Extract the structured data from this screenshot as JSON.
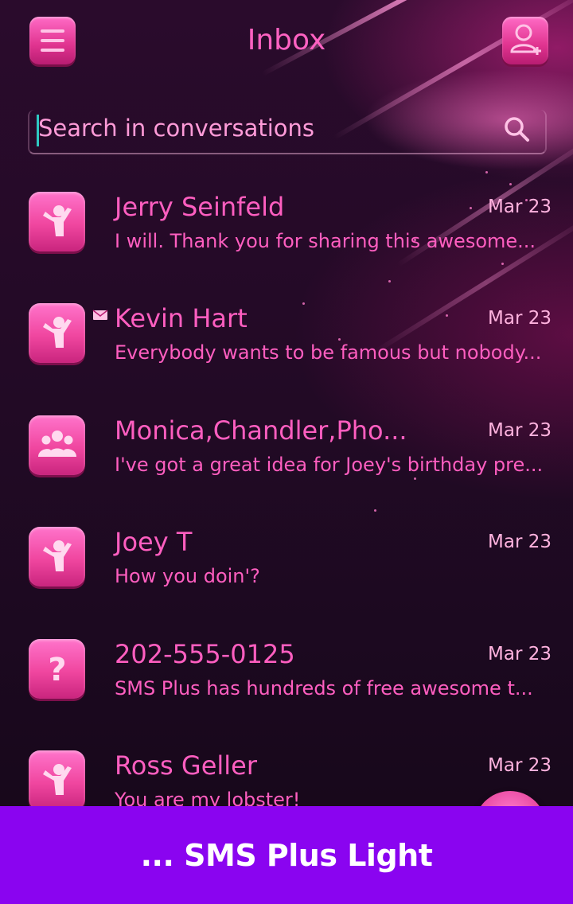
{
  "header": {
    "title": "Inbox",
    "menu_icon": "menu-icon",
    "add_contact_icon": "add-contact-icon"
  },
  "search": {
    "placeholder": "Search in conversations",
    "icon": "search-icon"
  },
  "conversations": [
    {
      "name": "Jerry Seinfeld",
      "date": "Mar 23",
      "snippet": "I will. Thank you for sharing this awesome...",
      "avatar": "person-icon",
      "unread": false
    },
    {
      "name": "Kevin Hart",
      "date": "Mar 23",
      "snippet": "Everybody wants to be famous but nobody...",
      "avatar": "person-icon",
      "unread": true
    },
    {
      "name": "Monica,Chandler,Pho...",
      "date": "Mar 23",
      "snippet": "I've got a great idea for Joey's birthday pre...",
      "avatar": "group-icon",
      "unread": false
    },
    {
      "name": "Joey T",
      "date": "Mar 23",
      "snippet": "How you doin'?",
      "avatar": "person-icon",
      "unread": false
    },
    {
      "name": "202-555-0125",
      "date": "Mar 23",
      "snippet": "SMS Plus has hundreds of free awesome t...",
      "avatar": "unknown-contact-icon",
      "unread": false
    },
    {
      "name": "Ross Geller",
      "date": "Mar 23",
      "snippet": " You are my lobster!",
      "avatar": "person-icon",
      "unread": false
    }
  ],
  "banner": {
    "text": "... SMS Plus Light"
  },
  "colors": {
    "accent": "#ff5ec0",
    "banner": "#8a04f0",
    "background": "#1c0920"
  }
}
